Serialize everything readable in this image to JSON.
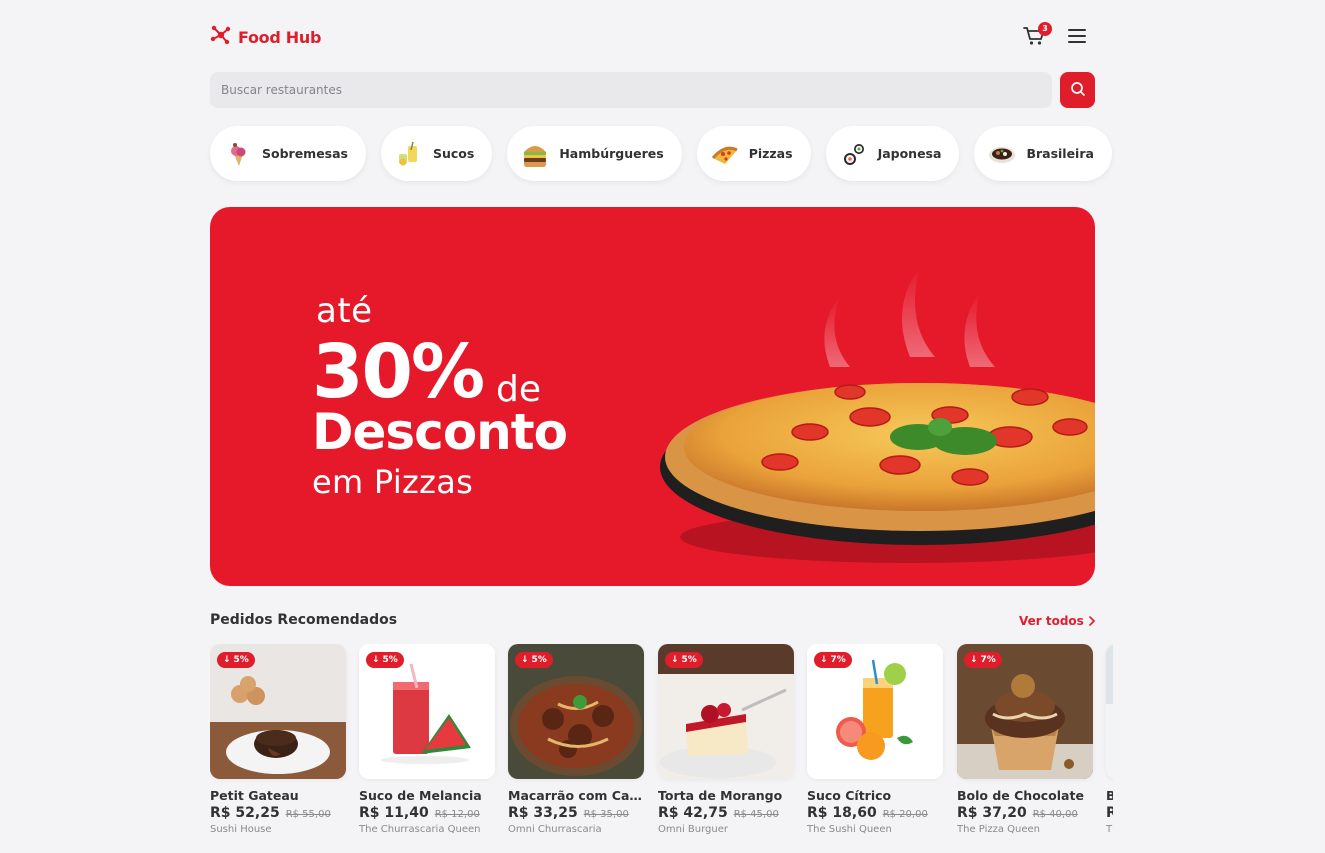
{
  "header": {
    "logo_text": "Food Hub",
    "cart_count": "3"
  },
  "search": {
    "placeholder": "Buscar restaurantes"
  },
  "categories": [
    {
      "label": "Sobremesas",
      "icon": "ice-cream-icon"
    },
    {
      "label": "Sucos",
      "icon": "juice-icon"
    },
    {
      "label": "Hambúrgueres",
      "icon": "burger-icon"
    },
    {
      "label": "Pizzas",
      "icon": "pizza-slice-icon"
    },
    {
      "label": "Japonesa",
      "icon": "sushi-icon"
    },
    {
      "label": "Brasileira",
      "icon": "feijoada-icon"
    }
  ],
  "banner": {
    "line1": "até",
    "line2": "30%",
    "line2_suffix": "de",
    "line3": "Desconto",
    "line4": "em Pizzas"
  },
  "recommended": {
    "title": "Pedidos Recomendados",
    "see_all": "Ver todos",
    "products": [
      {
        "name": "Petit Gateau",
        "price": "R$ 52,25",
        "old_price": "R$ 55,00",
        "restaurant": "Sushi House",
        "discount": "5%"
      },
      {
        "name": "Suco de Melancia",
        "price": "R$ 11,40",
        "old_price": "R$ 12,00",
        "restaurant": "The Churrascaria Queen",
        "discount": "5%"
      },
      {
        "name": "Macarrão com Carne",
        "price": "R$ 33,25",
        "old_price": "R$ 35,00",
        "restaurant": "Omni Churrascaria",
        "discount": "5%"
      },
      {
        "name": "Torta de Morango",
        "price": "R$ 42,75",
        "old_price": "R$ 45,00",
        "restaurant": "Omni Burguer",
        "discount": "5%"
      },
      {
        "name": "Suco Cítrico",
        "price": "R$ 18,60",
        "old_price": "R$ 20,00",
        "restaurant": "The Sushi Queen",
        "discount": "7%"
      },
      {
        "name": "Bolo de Chocolate",
        "price": "R$ 37,20",
        "old_price": "R$ 40,00",
        "restaurant": "The Pizza Queen",
        "discount": "7%"
      },
      {
        "name": "B",
        "price": "R",
        "old_price": "",
        "restaurant": "T",
        "discount": ""
      }
    ]
  },
  "colors": {
    "brand": "#e01e2b",
    "background": "#f4f4f6"
  }
}
